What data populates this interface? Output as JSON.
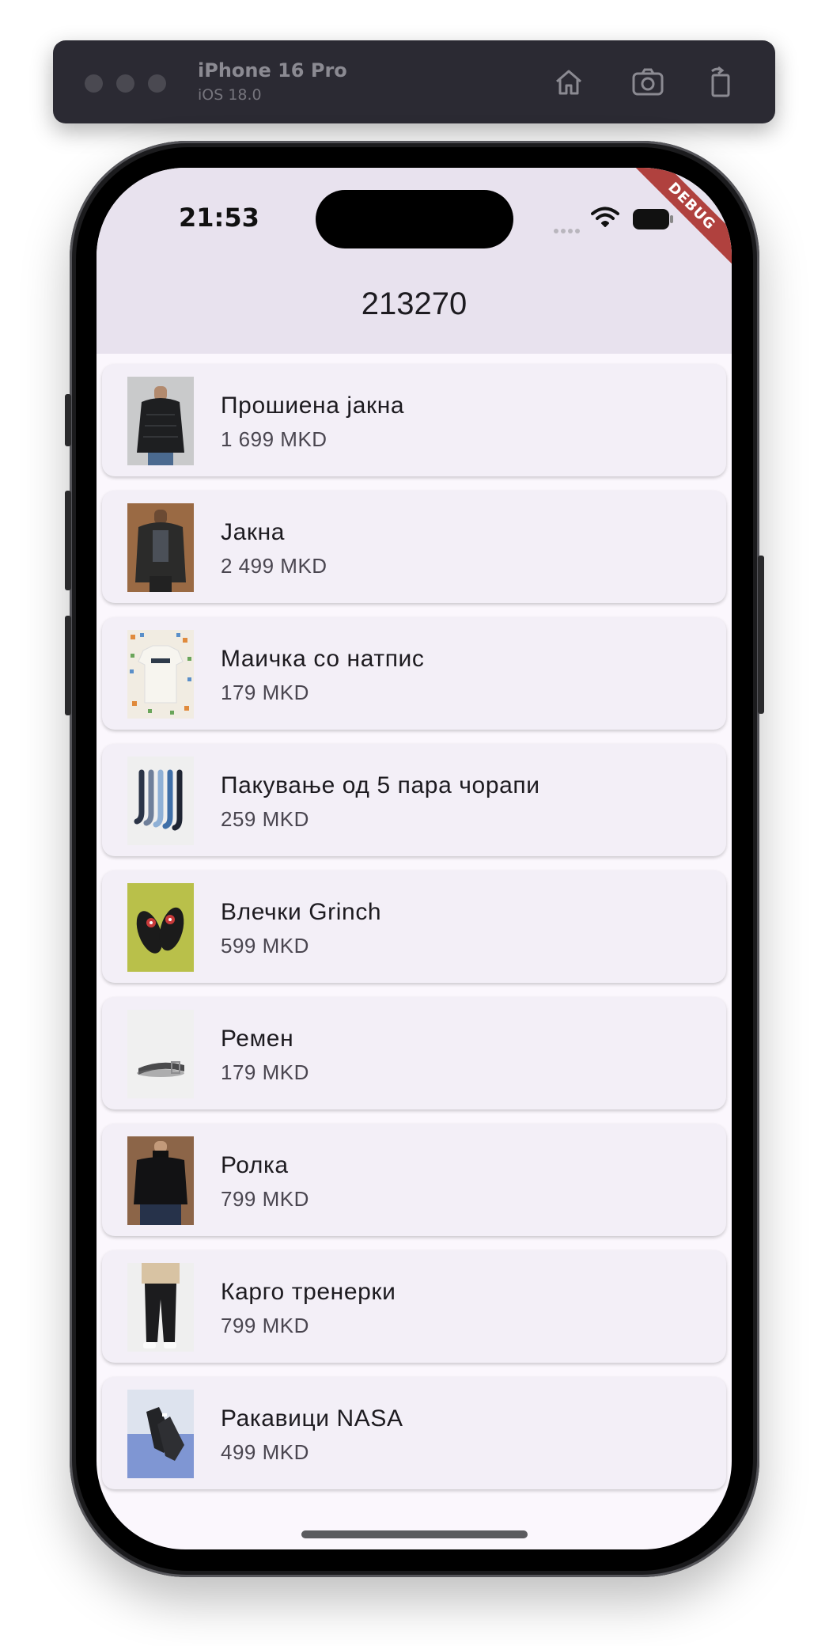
{
  "simulator": {
    "device_name": "iPhone 16 Pro",
    "os_version": "iOS 18.0",
    "toolbar_icons": [
      "home-icon",
      "screenshot-icon",
      "rotate-icon"
    ]
  },
  "status_bar": {
    "time": "21:53",
    "icons": [
      "cellular-signal-icon",
      "wifi-icon",
      "battery-icon"
    ]
  },
  "debug_banner": "DEBUG",
  "app_bar": {
    "title": "213270"
  },
  "colors": {
    "app_bar_bg": "#e8e2ee",
    "card_bg": "#f3eff7",
    "screen_bg": "#fbf7fd",
    "debug_ribbon": "#b0413e"
  },
  "products": [
    {
      "name": "Прошиена јакна",
      "price": "1 699 MKD",
      "image": "black-puffer-jacket-image"
    },
    {
      "name": "Јакна",
      "price": "2 499 MKD",
      "image": "dark-jacket-image"
    },
    {
      "name": "Маичка со натпис",
      "price": "179 MKD",
      "image": "printed-tshirt-image"
    },
    {
      "name": "Пакување од 5 пара чорапи",
      "price": "259 MKD",
      "image": "socks-pack-image"
    },
    {
      "name": "Влечки Grinch",
      "price": "599 MKD",
      "image": "grinch-slippers-image"
    },
    {
      "name": "Ремен",
      "price": "179 MKD",
      "image": "belt-image"
    },
    {
      "name": "Ролка",
      "price": "799 MKD",
      "image": "turtleneck-image"
    },
    {
      "name": "Карго тренерки",
      "price": "799 MKD",
      "image": "cargo-joggers-image"
    },
    {
      "name": "Ракавици NASA",
      "price": "499 MKD",
      "image": "nasa-gloves-image"
    }
  ]
}
